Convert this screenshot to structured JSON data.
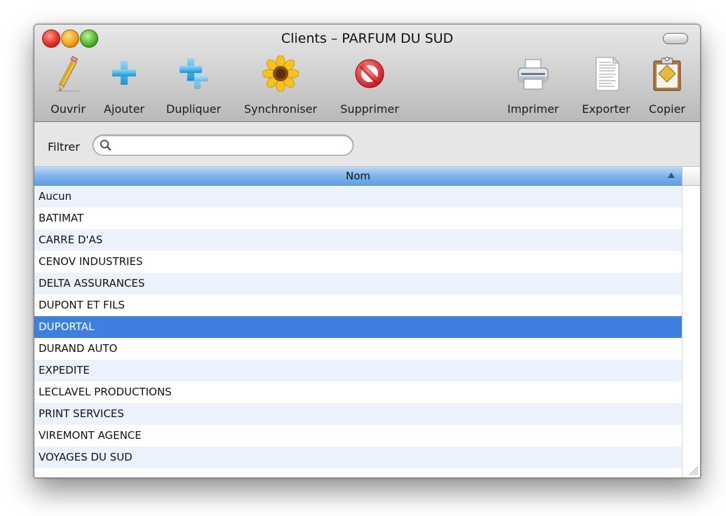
{
  "window": {
    "title": "Clients – PARFUM DU SUD"
  },
  "toolbar": {
    "left": [
      {
        "label": "Ouvrir",
        "icon": "pencil-icon"
      },
      {
        "label": "Ajouter",
        "icon": "plus-icon"
      },
      {
        "label": "Dupliquer",
        "icon": "duplicate-icon"
      },
      {
        "label": "Synchroniser",
        "icon": "sunflower-icon"
      },
      {
        "label": "Supprimer",
        "icon": "no-entry-icon"
      }
    ],
    "right": [
      {
        "label": "Imprimer",
        "icon": "printer-icon"
      },
      {
        "label": "Exporter",
        "icon": "document-icon"
      },
      {
        "label": "Copier",
        "icon": "clipboard-icon"
      }
    ]
  },
  "filter": {
    "label": "Filtrer",
    "value": "",
    "placeholder": ""
  },
  "table": {
    "column": "Nom",
    "sort": "ascending",
    "selected_index": 6,
    "rows": [
      "Aucun",
      "BATIMAT",
      "CARRE D'AS",
      "CENOV INDUSTRIES",
      "DELTA ASSURANCES",
      "DUPONT ET FILS",
      "DUPORTAL",
      "DURAND AUTO",
      "EXPEDITE",
      "LECLAVEL PRODUCTIONS",
      "PRINT SERVICES",
      "VIREMONT AGENCE",
      "VOYAGES DU SUD"
    ]
  },
  "colors": {
    "selection": "#3d80df",
    "stripe": "#edf3fe",
    "header": "#7eb4ea"
  }
}
